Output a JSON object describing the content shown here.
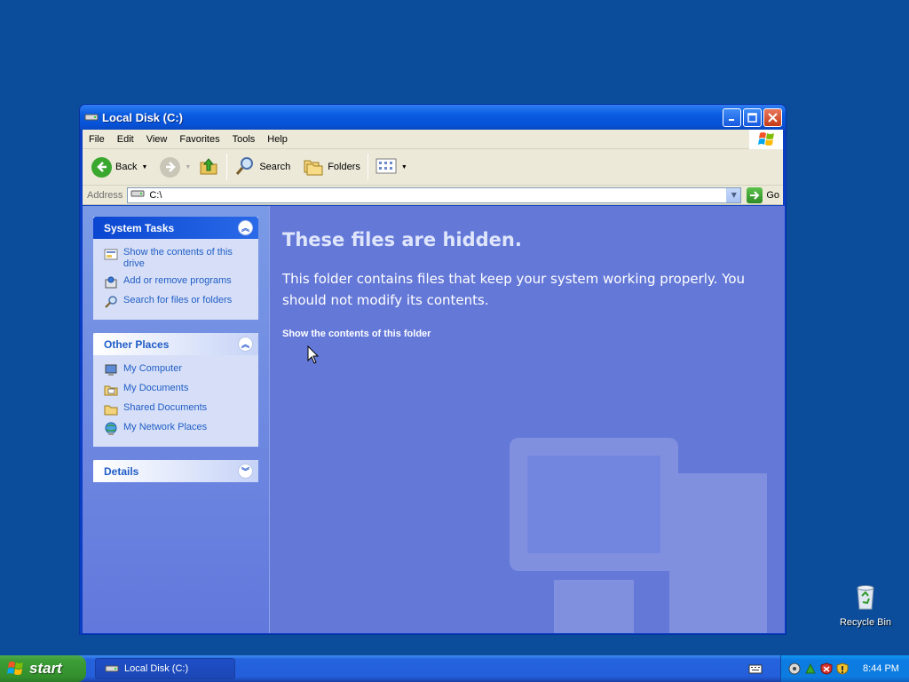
{
  "window": {
    "title": "Local Disk (C:)",
    "controls": {
      "minimize": "_",
      "maximize": "□",
      "close": "✕"
    }
  },
  "menu": [
    "File",
    "Edit",
    "View",
    "Favorites",
    "Tools",
    "Help"
  ],
  "toolbar": {
    "back": "Back",
    "search": "Search",
    "folders": "Folders"
  },
  "address": {
    "label": "Address",
    "value": "C:\\",
    "go": "Go"
  },
  "taskpane": {
    "system_tasks": {
      "title": "System Tasks",
      "items": [
        {
          "label": "Show the contents of this drive",
          "icon": "folder-view-icon"
        },
        {
          "label": "Add or remove programs",
          "icon": "programs-icon"
        },
        {
          "label": "Search for files or folders",
          "icon": "search-icon"
        }
      ]
    },
    "other_places": {
      "title": "Other Places",
      "items": [
        {
          "label": "My Computer",
          "icon": "computer-icon"
        },
        {
          "label": "My Documents",
          "icon": "documents-icon"
        },
        {
          "label": "Shared Documents",
          "icon": "folder-icon"
        },
        {
          "label": "My Network Places",
          "icon": "network-icon"
        }
      ]
    },
    "details": {
      "title": "Details"
    }
  },
  "main": {
    "heading": "These files are hidden.",
    "description": "This folder contains files that keep your system working properly. You should not modify its contents.",
    "show_link": "Show the contents of this folder"
  },
  "desktop": {
    "recycle_bin": "Recycle Bin"
  },
  "taskbar": {
    "start": "start",
    "active_task": "Local Disk (C:)",
    "clock": "8:44 PM"
  },
  "colors": {
    "desktop": "#0b4d9b",
    "titlebar": "#0a5ce0",
    "taskpane": "#7a9ae6",
    "mainpane": "#6478d8",
    "link": "#215dc6"
  }
}
